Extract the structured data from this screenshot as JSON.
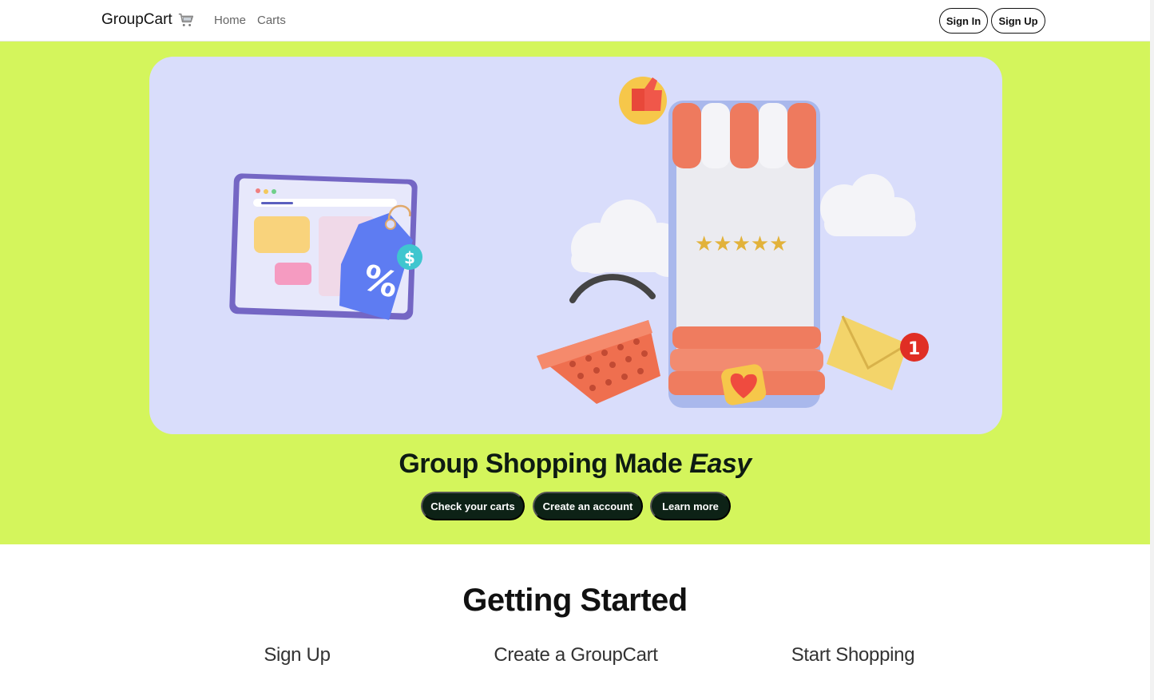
{
  "nav": {
    "brand": "GroupCart",
    "brand_icon": "shopping-cart-icon",
    "links": [
      "Home",
      "Carts"
    ],
    "sign_in": "Sign In",
    "sign_up": "Sign Up"
  },
  "hero": {
    "title_main": "Group Shopping Made ",
    "title_emphasis": "Easy",
    "buttons": [
      "Check your carts",
      "Create an account",
      "Learn more"
    ],
    "illustration_badge": "1",
    "colors": {
      "background": "#d4f55c",
      "card": "#d9ddfb",
      "button": "#0d2216"
    }
  },
  "getting_started": {
    "title": "Getting Started",
    "steps": [
      "Sign Up",
      "Create a GroupCart",
      "Start Shopping"
    ]
  }
}
